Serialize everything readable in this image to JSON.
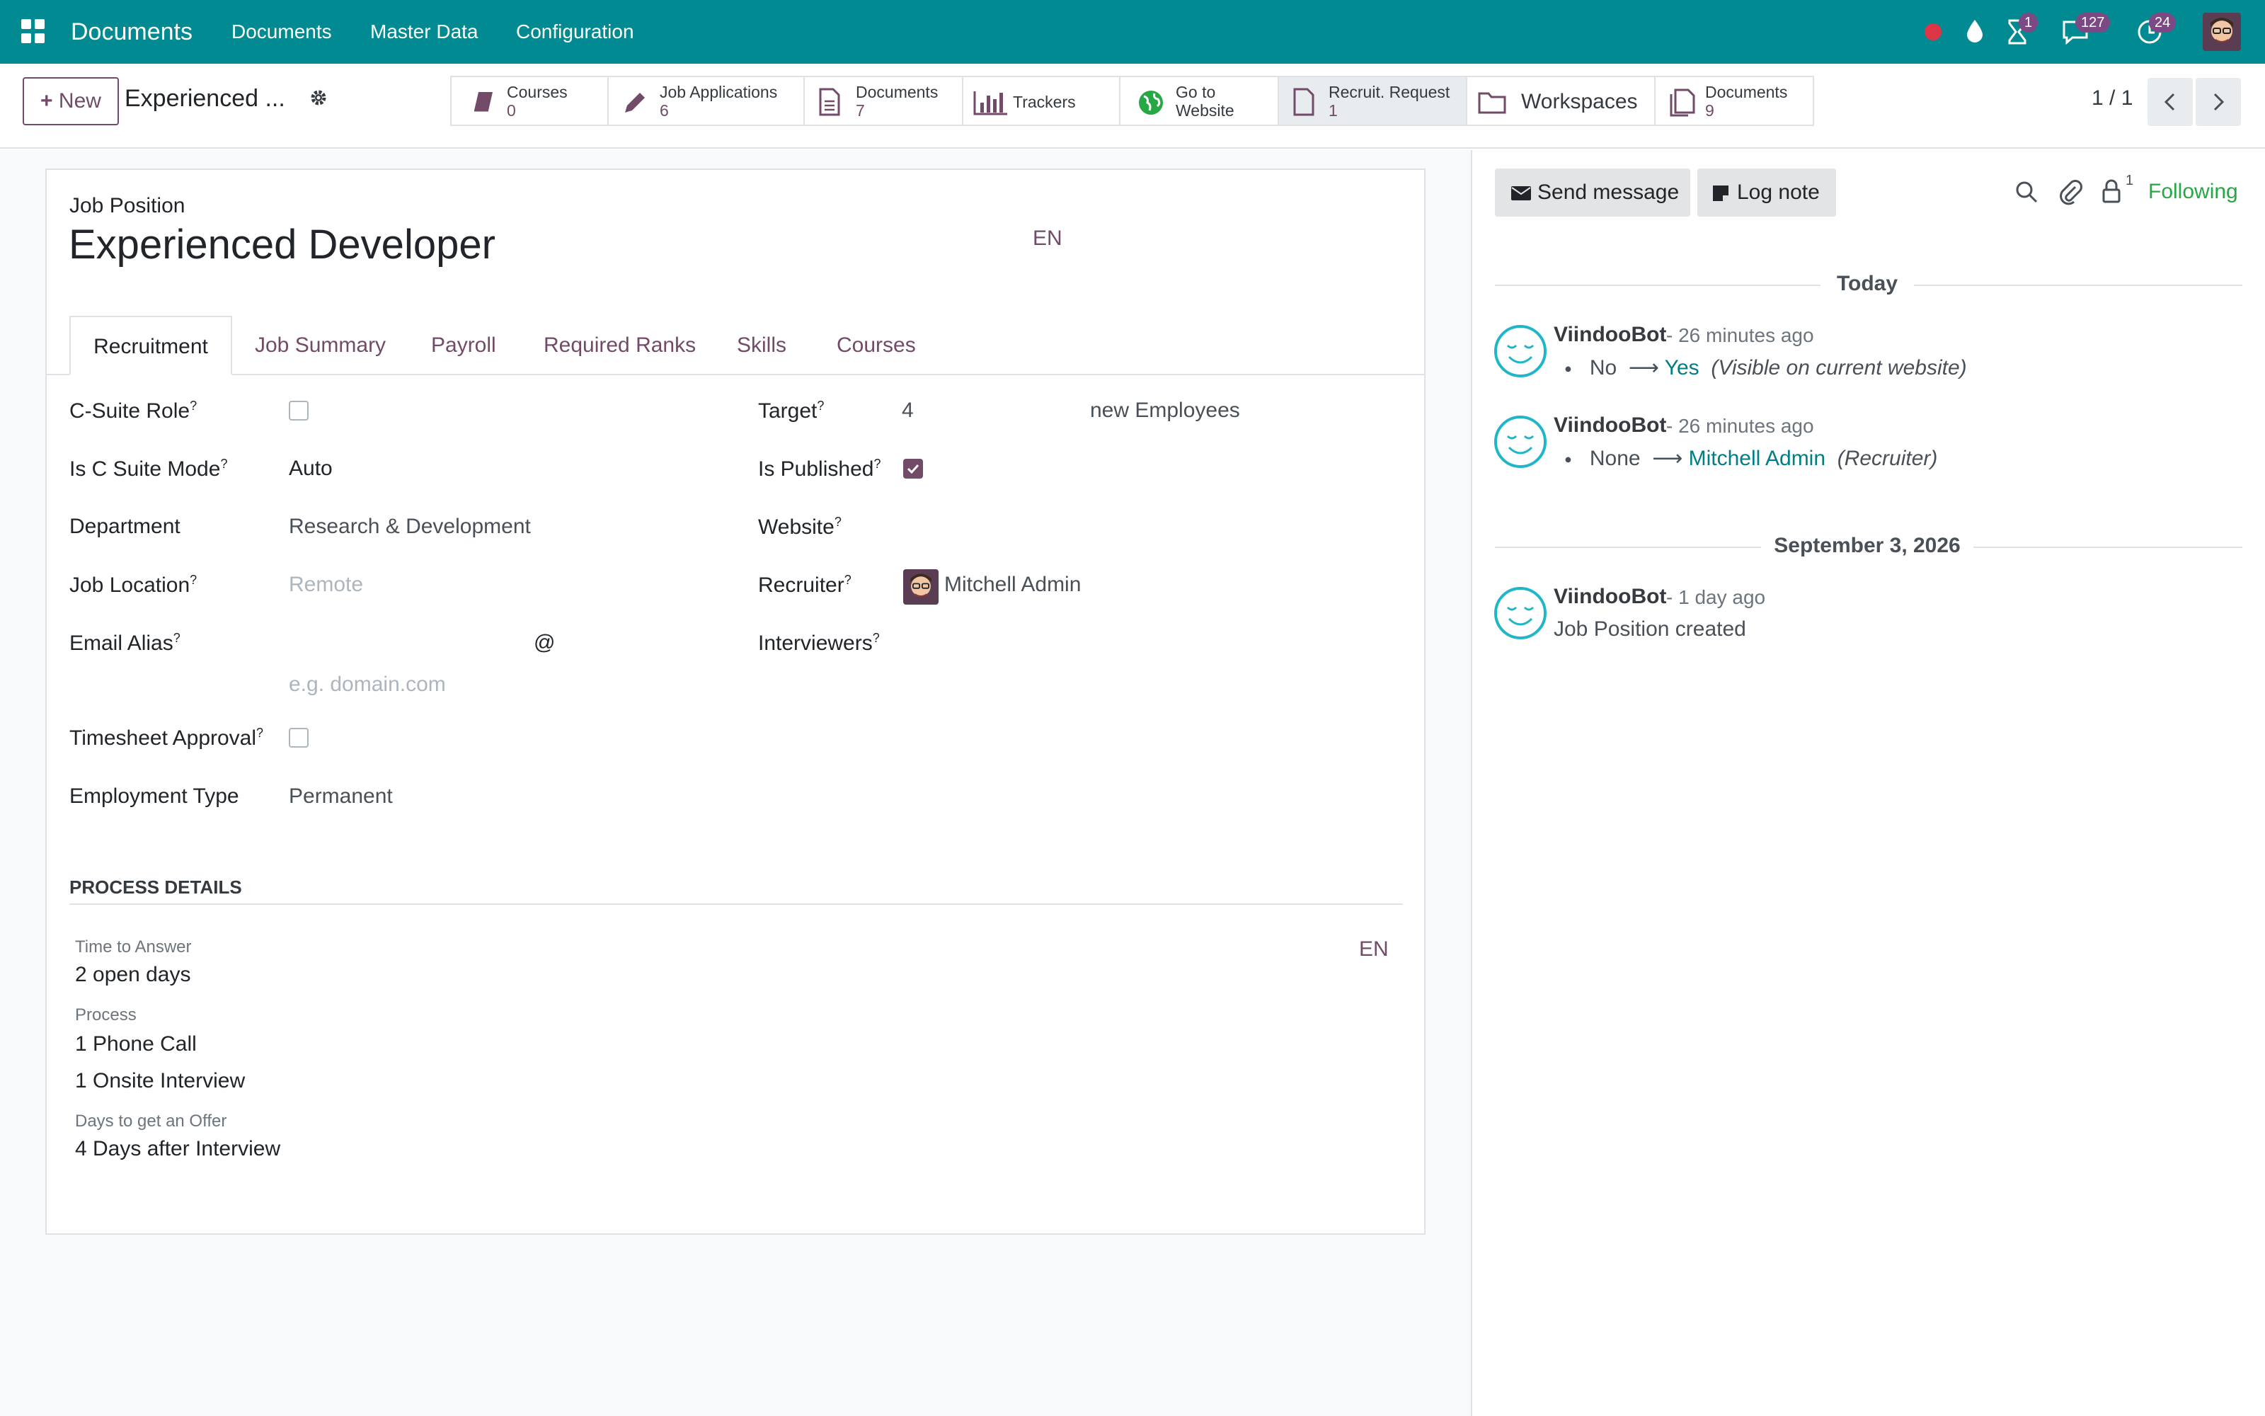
{
  "navbar": {
    "app_name": "Documents",
    "menu": [
      "Documents",
      "Master Data",
      "Configuration"
    ],
    "activity_badge": "1",
    "messages_badge": "127",
    "clock_badge": "24"
  },
  "control_panel": {
    "new_button": "New",
    "breadcrumb": "Experienced ...",
    "smart_buttons": [
      {
        "label": "Courses",
        "value": "0"
      },
      {
        "label": "Job Applications",
        "value": "6"
      },
      {
        "label": "Documents",
        "value": "7"
      },
      {
        "label": "Trackers"
      },
      {
        "label_line1": "Go to",
        "label_line2": "Website"
      },
      {
        "label": "Recruit. Request",
        "value": "1"
      },
      {
        "label": "Workspaces"
      },
      {
        "label": "Documents",
        "value": "9"
      }
    ],
    "pager": "1 / 1"
  },
  "form": {
    "header_label": "Job Position",
    "title": "Experienced Developer",
    "lang": "EN",
    "tabs": [
      "Recruitment",
      "Job Summary",
      "Payroll",
      "Required Ranks",
      "Skills",
      "Courses"
    ],
    "active_tab": "Recruitment",
    "left_fields": {
      "c_suite_role": {
        "label": "C-Suite Role",
        "checked": false
      },
      "c_suite_mode": {
        "label": "Is C Suite Mode",
        "value": "Auto"
      },
      "department": {
        "label": "Department",
        "value": "Research & Development"
      },
      "job_location": {
        "label": "Job Location",
        "placeholder": "Remote"
      },
      "email_alias": {
        "label": "Email Alias",
        "at": "@",
        "placeholder": "e.g. domain.com"
      },
      "timesheet_approval": {
        "label": "Timesheet Approval",
        "checked": false
      },
      "employment_type": {
        "label": "Employment Type",
        "value": "Permanent"
      }
    },
    "right_fields": {
      "target": {
        "label": "Target",
        "value": "4",
        "suffix": "new Employees"
      },
      "is_published": {
        "label": "Is Published",
        "checked": true
      },
      "website": {
        "label": "Website"
      },
      "recruiter": {
        "label": "Recruiter",
        "value": "Mitchell Admin"
      },
      "interviewers": {
        "label": "Interviewers"
      }
    },
    "process": {
      "section_title": "PROCESS DETAILS",
      "lang": "EN",
      "time_to_answer_label": "Time to Answer",
      "time_to_answer": "2 open days",
      "process_label": "Process",
      "process_lines": [
        "1 Phone Call",
        "1 Onsite Interview"
      ],
      "days_offer_label": "Days to get an Offer",
      "days_offer": "4 Days after Interview"
    },
    "help_mark": "?"
  },
  "chatter": {
    "send_message": "Send message",
    "log_note": "Log note",
    "followers_count": "1",
    "following": "Following",
    "today_label": "Today",
    "older_label": "September 3, 2026",
    "messages": [
      {
        "author": "ViindooBot",
        "time": "- 26 minutes ago",
        "old": "No",
        "new": "Yes",
        "note": "(Visible on current website)"
      },
      {
        "author": "ViindooBot",
        "time": "- 26 minutes ago",
        "old": "None",
        "new": "Mitchell Admin",
        "note": "(Recruiter)"
      },
      {
        "author": "ViindooBot",
        "time": "- 1 day ago",
        "body": "Job Position created"
      }
    ]
  },
  "colors": {
    "navbar": "#018a91",
    "accent": "#714b67",
    "link": "#017e84",
    "following": "#28a745"
  }
}
